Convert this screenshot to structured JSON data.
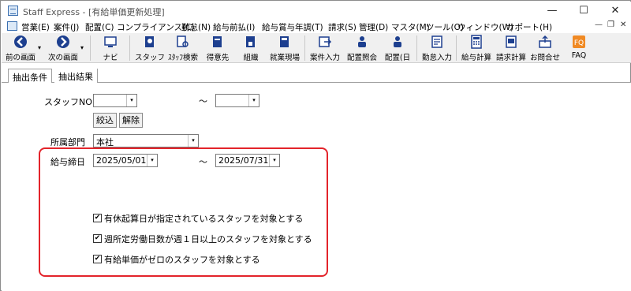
{
  "window": {
    "title": "Staff Express - [有給単価更新処理]",
    "min": "—",
    "max": "☐",
    "close": "✕"
  },
  "menu": {
    "items": [
      "営業(E)",
      "案件(J)",
      "配置(C)",
      "コンプライアンス(C)",
      "勤怠(N)",
      "給与前払(I)",
      "給与賞与年調(T)",
      "請求(S)",
      "管理(D)",
      "マスタ(M)",
      "ツール(O)",
      "ウィンドウ(W)",
      "サポート(H)"
    ],
    "mdi_min": "—",
    "mdi_restore": "❐",
    "mdi_close": "✕"
  },
  "toolbar": {
    "items": [
      "前の画面",
      "次の画面",
      "ナビ",
      "スタッフ",
      "ｽﾀｯﾌ検索",
      "得意先",
      "組織",
      "就業現場",
      "案件入力",
      "配置照会",
      "配置(日",
      "勤怠入力",
      "給与計算",
      "請求計算",
      "お問合せ",
      "FAQ"
    ]
  },
  "tabs": [
    "抽出条件",
    "抽出結果"
  ],
  "form": {
    "staff_no_label": "スタッフNO",
    "range_sep": "～",
    "staff_no_from": "",
    "staff_no_to": "",
    "filter_button": "絞込",
    "clear_button": "解除",
    "dept_label": "所属部門",
    "dept_value": "本社",
    "pay_date_label": "給与締日",
    "pay_date_from": "2025/05/01",
    "pay_date_to": "2025/07/31",
    "options": [
      {
        "label": "有休起算日が指定されているスタッフを対象とする",
        "checked": true
      },
      {
        "label": "週所定労働日数が週１日以上のスタッフを対象とする",
        "checked": true
      },
      {
        "label": "有給単価がゼロのスタッフを対象とする",
        "checked": true
      }
    ]
  },
  "check_mark": "✔",
  "arrow": "▾"
}
